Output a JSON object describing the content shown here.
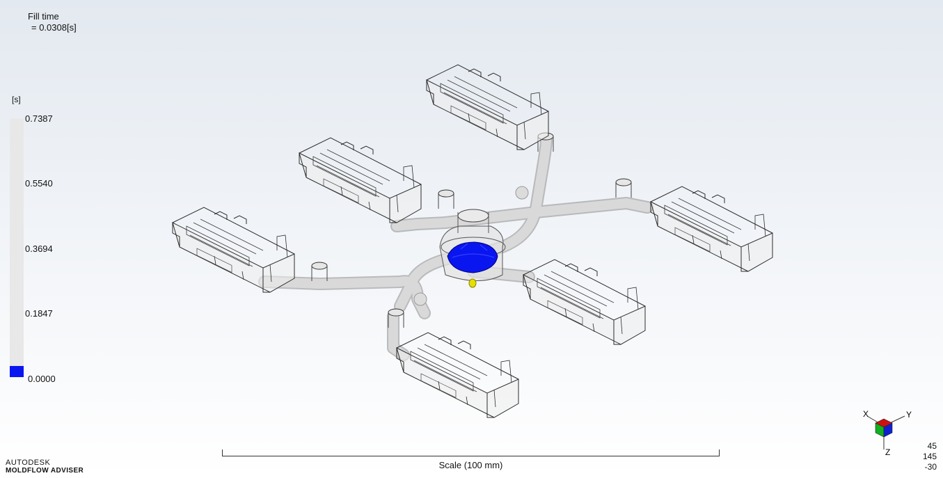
{
  "result": {
    "name": "Fill time",
    "value": "=  0.0308[s]"
  },
  "legend": {
    "unit": "[s]",
    "ticks": [
      "0.7387",
      "0.5540",
      "0.3694",
      "0.1847",
      "0.0000"
    ],
    "fill_color": "#0a16f0",
    "fill_level_fraction": 0.042
  },
  "scale": {
    "label": "Scale (100 mm)"
  },
  "brand": {
    "line1": "AUTODESK",
    "line2": "MOLDFLOW ADVISER"
  },
  "triad": {
    "x_label": "X",
    "y_label": "Y",
    "z_label": "Z"
  },
  "view_angles": {
    "a": "45",
    "b": "145",
    "c": "-30"
  },
  "colors": {
    "filled_melt": "#0a16f0",
    "injection_point": "#e5e000",
    "runner": "#c8c8c8",
    "part_outline": "#2b2b2b"
  }
}
